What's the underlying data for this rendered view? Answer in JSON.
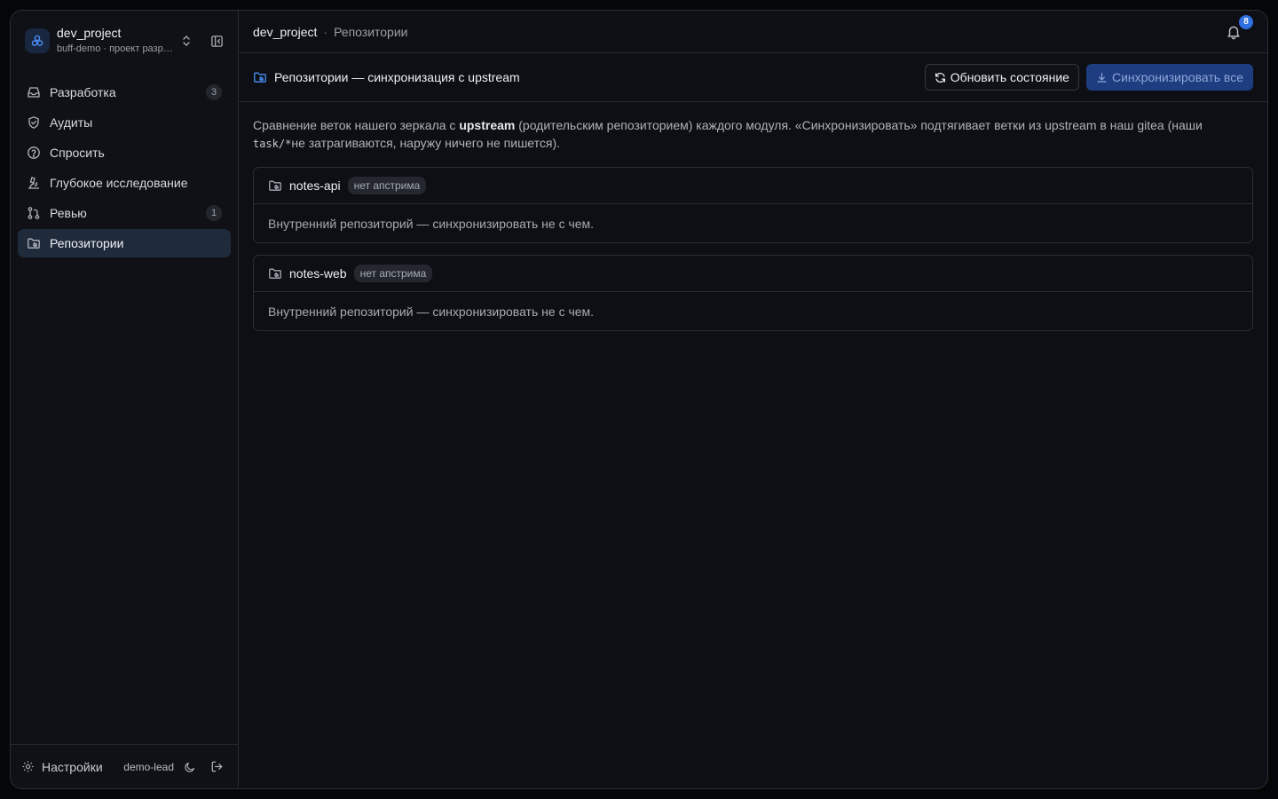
{
  "sidebar": {
    "project_name": "dev_project",
    "project_sub": "buff-demo · проект разработки",
    "items": [
      {
        "label": "Разработка",
        "badge": "3",
        "icon": "inbox-icon"
      },
      {
        "label": "Аудиты",
        "badge": "",
        "icon": "shield-check-icon"
      },
      {
        "label": "Спросить",
        "badge": "",
        "icon": "help-circle-icon"
      },
      {
        "label": "Глубокое исследование",
        "badge": "",
        "icon": "microscope-icon"
      },
      {
        "label": "Ревью",
        "badge": "1",
        "icon": "git-pull-request-icon"
      },
      {
        "label": "Репозитории",
        "badge": "",
        "icon": "folder-git-icon",
        "active": true
      }
    ],
    "footer": {
      "settings_label": "Настройки",
      "user": "demo-lead"
    }
  },
  "topbar": {
    "project": "dev_project",
    "separator": "·",
    "page": "Репозитории",
    "notifications": "8"
  },
  "pagebar": {
    "title": "Репозитории — синхронизация с upstream",
    "refresh_label": "Обновить состояние",
    "sync_all_label": "Синхронизировать все"
  },
  "description": {
    "part1": "Сравнение веток нашего зеркала с ",
    "bold": "upstream",
    "part2": " (родительским репозиторием) каждого модуля. «Синхронизировать» подтягивает ветки из upstream в наш gitea (наши ",
    "code": "task/*",
    "part3": "не затрагиваются, наружу ничего не пишется)."
  },
  "repos": [
    {
      "name": "notes-api",
      "pill": "нет апстрима",
      "message": "Внутренний репозиторий — синхронизировать не с чем."
    },
    {
      "name": "notes-web",
      "pill": "нет апстрима",
      "message": "Внутренний репозиторий — синхронизировать не с чем."
    }
  ],
  "colors": {
    "accent": "#2f6fe0",
    "primary_button": "#1d3d80",
    "background": "#0d0f14"
  }
}
